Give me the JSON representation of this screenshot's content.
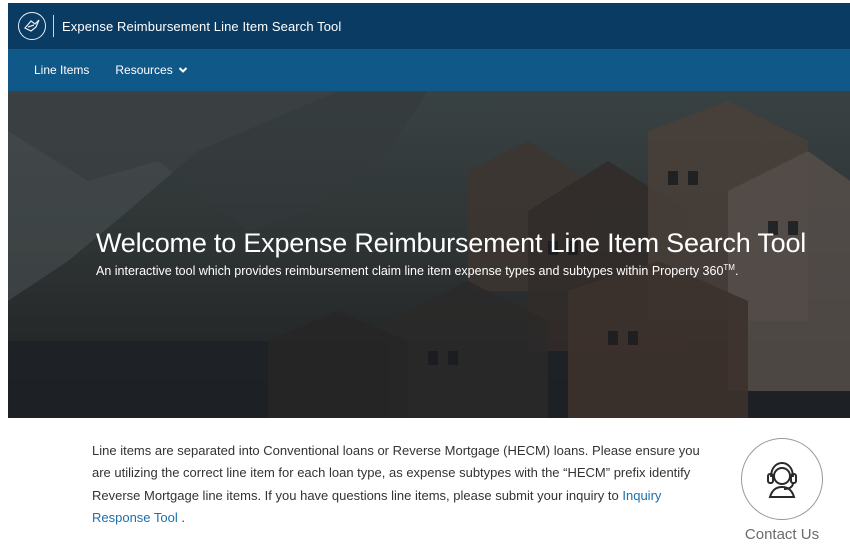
{
  "header": {
    "app_title": "Expense Reimbursement Line Item Search Tool",
    "logo_icon": "hud-eagle-logo-icon"
  },
  "nav": {
    "items": [
      {
        "label": "Line Items"
      },
      {
        "label": "Resources",
        "icon": "chevron-down-icon"
      }
    ]
  },
  "hero": {
    "title": "Welcome to Expense Reimbursement Line Item Search Tool",
    "subtitle": "An interactive tool which provides reimbursement claim line item expense types and subtypes within Property 360",
    "trademark": "TM",
    "subtitle_end": "."
  },
  "body": {
    "text_before_link": "Line items are separated into Conventional loans or Reverse Mortgage (HECM) loans. Please ensure you are utilizing the correct line item for each loan type, as expense subtypes with the “HECM” prefix identify Reverse Mortgage line items. If you have questions line items, please submit your inquiry to ",
    "link_text": "Inquiry Response Tool",
    "text_after_link": " ."
  },
  "contact": {
    "label": "Contact Us",
    "icon": "headset-support-icon"
  },
  "colors": {
    "topbar": "#0a3b63",
    "navbar": "#105887",
    "link": "#1a6fb0"
  }
}
